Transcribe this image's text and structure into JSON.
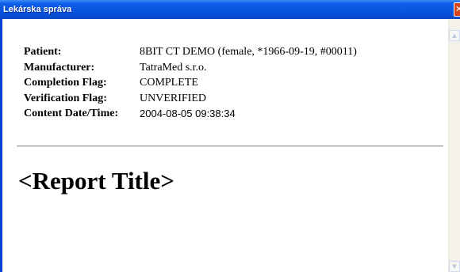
{
  "window": {
    "title": "Lekárska správa",
    "close_glyph": "✕"
  },
  "report": {
    "fields": [
      {
        "label": "Patient:",
        "value": "8BIT CT DEMO (female, *1966-09-19, #00011)"
      },
      {
        "label": "Manufacturer:",
        "value": "TatraMed s.r.o."
      },
      {
        "label": "Completion Flag:",
        "value": "COMPLETE"
      },
      {
        "label": "Verification Flag:",
        "value": "UNVERIFIED"
      },
      {
        "label": "Content Date/Time:",
        "value": "2004-08-05 09:38:34"
      }
    ],
    "title": "<Report Title>"
  },
  "scrollbar": {
    "up_icon": "chevron-up-icon",
    "down_icon": "chevron-down-icon"
  },
  "colors": {
    "titlebar": "#0a55e0",
    "frame": "#0a3fd8",
    "close": "#d9431a",
    "scroll_track": "#f3f1ea"
  }
}
